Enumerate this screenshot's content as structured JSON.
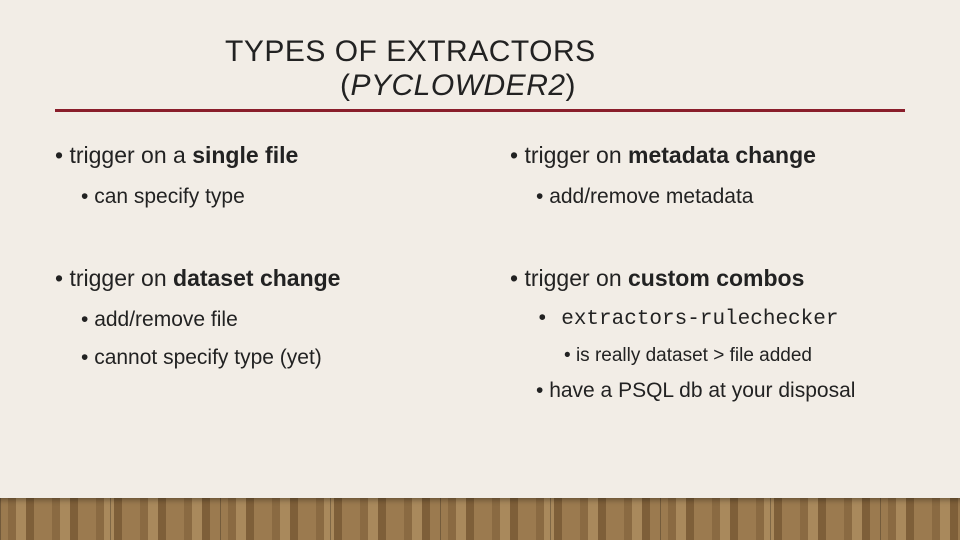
{
  "title": {
    "line1": "TYPES OF EXTRACTORS",
    "line2_sub": "PYCLOWDER2"
  },
  "left": {
    "a_head_pre": "trigger on a ",
    "a_head_bold": "single file",
    "a_sub1": "can specify type",
    "b_head_pre": "trigger on ",
    "b_head_bold": "dataset change",
    "b_sub1": "add/remove file",
    "b_sub2": "cannot specify type (yet)"
  },
  "right": {
    "a_head_pre": "trigger on ",
    "a_head_bold": "metadata change",
    "a_sub1": "add/remove metadata",
    "b_head_pre": "trigger on ",
    "b_head_bold": "custom combos",
    "b_sub1": "extractors-rulechecker",
    "b_sub1_sub": "is really dataset > file added",
    "b_sub2": "have a PSQL db at your disposal"
  }
}
